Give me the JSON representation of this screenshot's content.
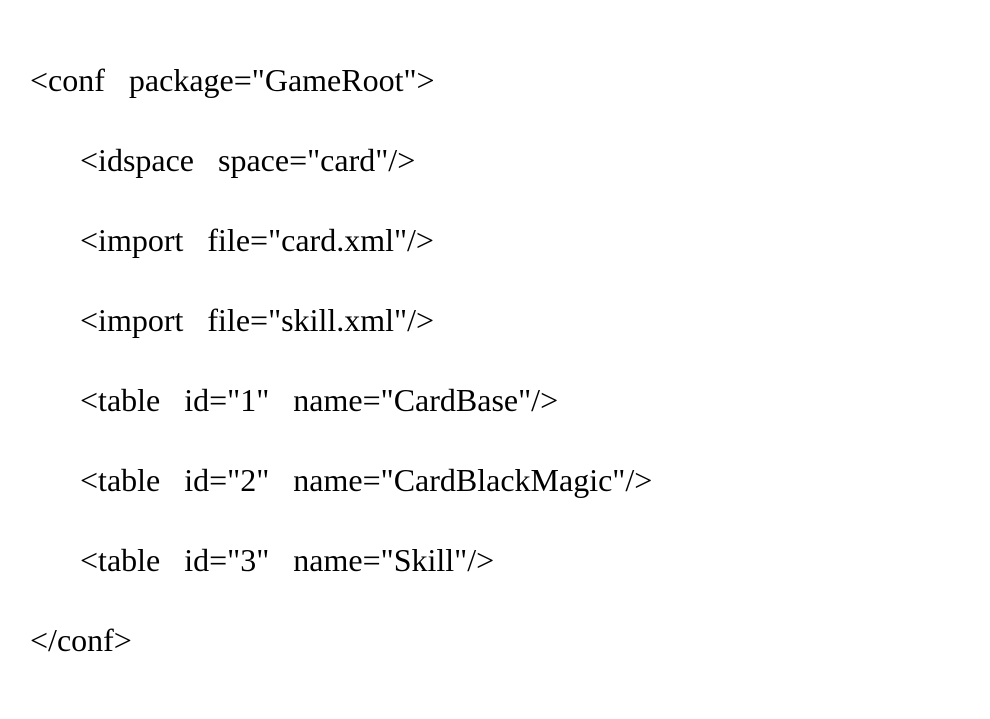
{
  "code": {
    "open_tag": "<conf   package=\"GameRoot\">",
    "idspace": "<idspace   space=\"card\"/>",
    "import1": "<import   file=\"card.xml\"/>",
    "import2": "<import   file=\"skill.xml\"/>",
    "table1": "<table   id=\"1\"   name=\"CardBase\"/>",
    "table2": "<table   id=\"2\"   name=\"CardBlackMagic\"/>",
    "table3": "<table   id=\"3\"   name=\"Skill\"/>",
    "close_tag": "</conf>"
  }
}
